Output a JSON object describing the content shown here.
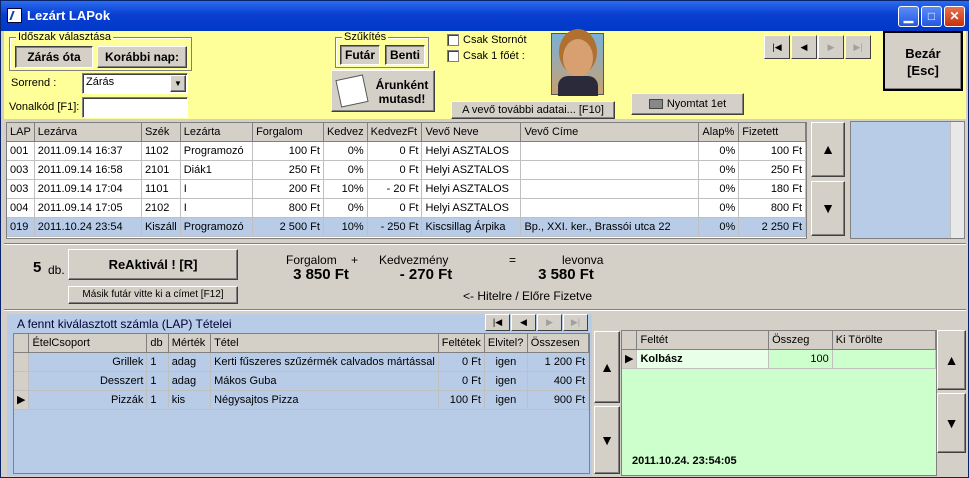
{
  "window": {
    "title": "Lezárt LAPok"
  },
  "period": {
    "legend": "Időszak választása",
    "btn_since_close": "Zárás óta",
    "btn_earlier_day": "Korábbi nap:"
  },
  "sort": {
    "label": "Sorrend :",
    "value": "Zárás",
    "barcode_label": "Vonalkód [F1]:",
    "barcode_value": ""
  },
  "filter": {
    "legend": "Szűkítés",
    "btn_courier": "Futár",
    "btn_inside": "Benti"
  },
  "unit_price_btn": "Árunként mutasd!",
  "checks": {
    "storno": "Csak Stornót",
    "one_person": "Csak 1 főét :"
  },
  "customer_more_btn": "A vevő további adatai... [F10]",
  "print_btn": "Nyomtat 1et",
  "close_btn": {
    "line1": "Bezár",
    "line2": "[Esc]"
  },
  "main_nav": {
    "first": "|◀",
    "prev": "◀",
    "next": "▶",
    "last": "▶|"
  },
  "main_table": {
    "headers": [
      "LAP",
      "Lezárva",
      "Szék",
      "Lezárta",
      "Forgalom",
      "Kedvez",
      "KedvezFt",
      "Vevő Neve",
      "Vevő Címe",
      "Alap%",
      "Fizetett"
    ],
    "rows": [
      [
        "001",
        "2011.09.14 16:37",
        "1102",
        "Programozó",
        "100 Ft",
        "0%",
        "0 Ft",
        "Helyi ASZTALOS",
        "",
        "0%",
        "100 Ft"
      ],
      [
        "003",
        "2011.09.14 16:58",
        "2101",
        "Diák1",
        "250 Ft",
        "0%",
        "0 Ft",
        "Helyi ASZTALOS",
        "",
        "0%",
        "250 Ft"
      ],
      [
        "003",
        "2011.09.14 17:04",
        "1101",
        "I",
        "200 Ft",
        "10%",
        "- 20 Ft",
        "Helyi ASZTALOS",
        "",
        "0%",
        "180 Ft"
      ],
      [
        "004",
        "2011.09.14 17:05",
        "2102",
        "I",
        "800 Ft",
        "0%",
        "0 Ft",
        "Helyi ASZTALOS",
        "",
        "0%",
        "800 Ft"
      ],
      [
        "019",
        "2011.10.24 23:54",
        "Kiszáll",
        "Programozó",
        "2 500 Ft",
        "10%",
        "- 250 Ft",
        "Kiscsillag Árpika",
        "Bp., XXI. ker., Brassói  utca 22",
        "0%",
        "2 250 Ft"
      ]
    ]
  },
  "summary": {
    "count": "5",
    "count_unit": "db.",
    "reactivate_btn": "ReAktivál !  [R]",
    "other_courier_btn": "Másik futár vitte ki a címet [F12]",
    "turnover_label": "Forgalom",
    "plus": "+",
    "discount_label": "Kedvezmény",
    "equals": "=",
    "deducted_label": "levonva",
    "turnover_value": "3 850 Ft",
    "discount_value": "- 270 Ft",
    "deducted_value": "3 580 Ft",
    "credit_note": "<- Hitelre / Előre Fizetve"
  },
  "items": {
    "title": "A fennt kiválasztott számla (LAP) Tételei",
    "headers": [
      "ÉtelCsoport",
      "db",
      "Mérték",
      "Tétel",
      "Feltétek",
      "Elvitel?",
      "Összesen"
    ],
    "rows": [
      [
        "Grillek",
        "1",
        "adag",
        "Kerti fűszeres szűzérmék calvados mártással",
        "0 Ft",
        "igen",
        "1 200 Ft"
      ],
      [
        "Desszert",
        "1",
        "adag",
        "Mákos Guba",
        "0 Ft",
        "igen",
        "400 Ft"
      ],
      [
        "Pizzák",
        "1",
        "kis",
        "Négysajtos Pizza",
        "100 Ft",
        "igen",
        "900 Ft"
      ]
    ]
  },
  "toppings": {
    "headers": [
      "Feltét",
      "Összeg",
      "Ki Törölte"
    ],
    "rows": [
      [
        "Kolbász",
        "100",
        ""
      ]
    ],
    "timestamp": "2011.10.24. 23:54:05"
  }
}
